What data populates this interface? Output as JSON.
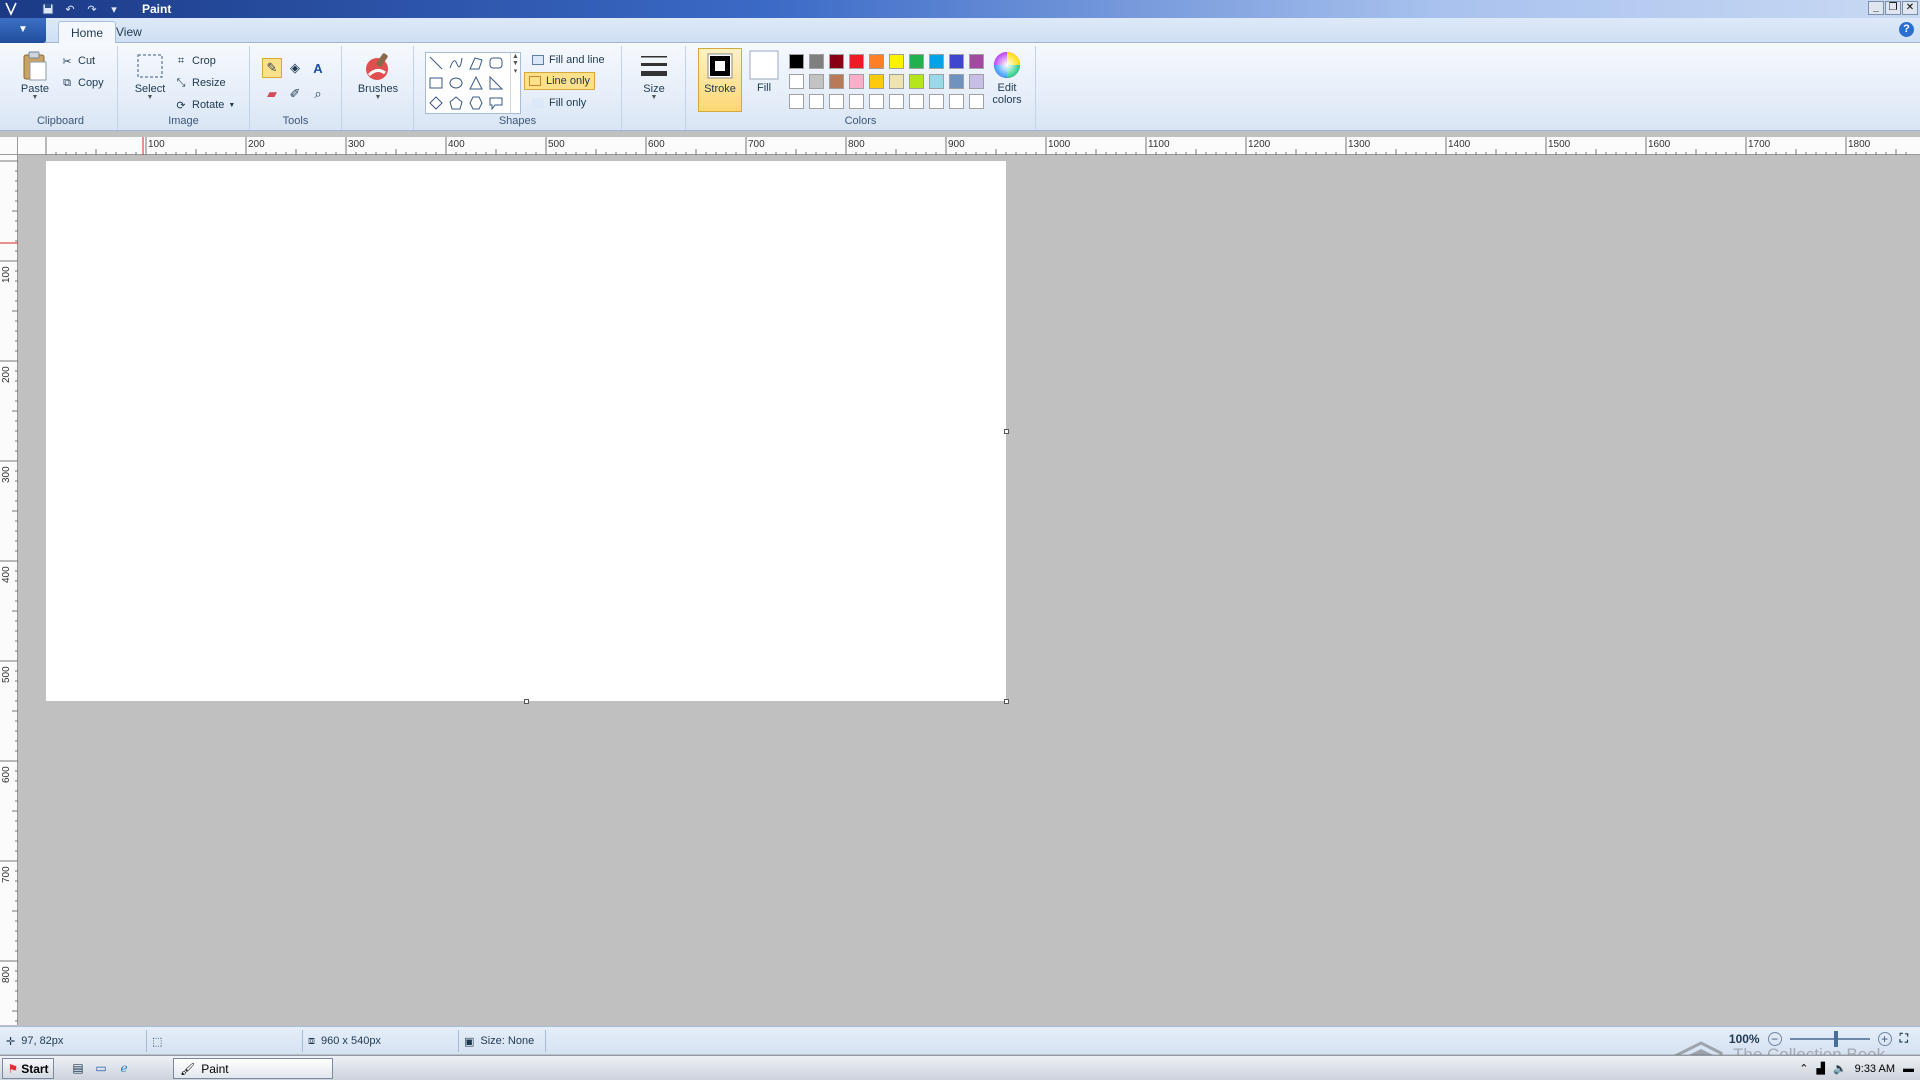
{
  "window": {
    "title": "Paint",
    "controls": {
      "minimize": "_",
      "restore": "❐",
      "close": "✕"
    }
  },
  "tabs": [
    {
      "label": "Home",
      "active": true
    },
    {
      "label": "View",
      "active": false
    }
  ],
  "ribbon": {
    "clipboard": {
      "label": "Clipboard",
      "paste": "Paste",
      "cut": "Cut",
      "copy": "Copy"
    },
    "image": {
      "label": "Image",
      "select": "Select",
      "crop": "Crop",
      "resize": "Resize",
      "rotate": "Rotate"
    },
    "tools": {
      "label": "Tools",
      "selected": "pencil"
    },
    "brushes": {
      "label": "Brushes"
    },
    "shapes": {
      "label": "Shapes",
      "fill_and_line": "Fill and line",
      "line_only": "Line only",
      "fill_only": "Fill only",
      "selected_option": "Line only"
    },
    "size": {
      "label": "Size"
    },
    "colors": {
      "label": "Colors",
      "stroke": "Stroke",
      "fill": "Fill",
      "edit_colors": "Edit colors",
      "stroke_color": "#000000",
      "fill_color": "#ffffff",
      "palette_row1": [
        "#000000",
        "#7f7f7f",
        "#880015",
        "#ed1c24",
        "#ff7f27",
        "#fff200",
        "#22b14c",
        "#00a2e8",
        "#3f48cc",
        "#a349a4"
      ],
      "palette_row2": [
        "#ffffff",
        "#c3c3c3",
        "#b97a57",
        "#ffaec9",
        "#ffc90e",
        "#efe4b0",
        "#b5e61d",
        "#99d9ea",
        "#7092be",
        "#c8bfe7"
      ],
      "palette_row3": [
        "#ffffff",
        "#ffffff",
        "#ffffff",
        "#ffffff",
        "#ffffff",
        "#ffffff",
        "#ffffff",
        "#ffffff",
        "#ffffff",
        "#ffffff"
      ]
    }
  },
  "rulers": {
    "horizontal": [
      "100",
      "200",
      "300",
      "400",
      "500",
      "600",
      "700",
      "800",
      "900",
      "1000",
      "1100",
      "1200",
      "1300",
      "1400",
      "1500",
      "1600",
      "1700",
      "1800"
    ],
    "vertical": [
      "100",
      "200",
      "300",
      "400",
      "500",
      "600",
      "700",
      "800"
    ]
  },
  "status": {
    "cursor_position": "97, 82px",
    "canvas_size": "960 x 540px",
    "file_size": "Size: None",
    "zoom": "100%"
  },
  "watermark": {
    "text": "The Collection Book"
  },
  "taskbar": {
    "start": "Start",
    "task": "Paint",
    "clock": "9:33 AM"
  }
}
